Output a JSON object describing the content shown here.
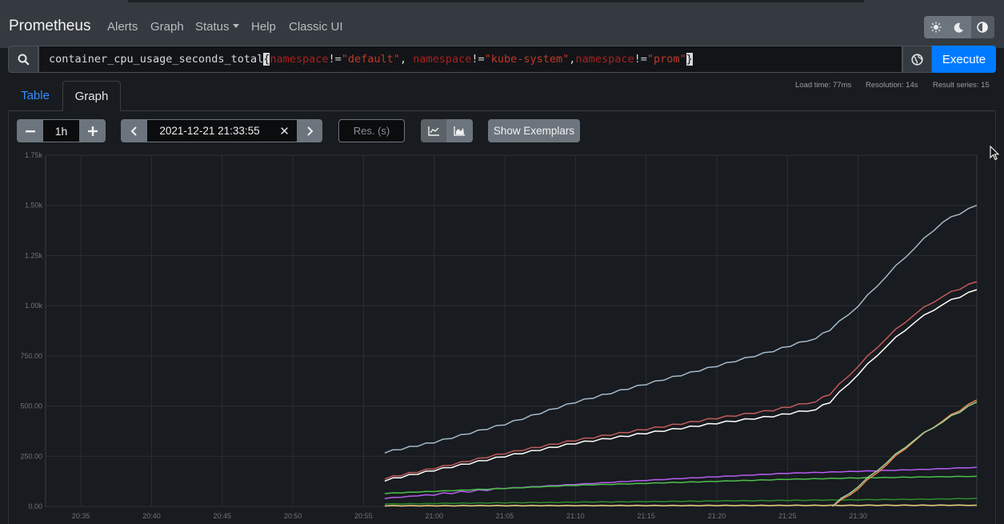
{
  "navbar": {
    "brand": "Prometheus",
    "items": [
      {
        "label": "Alerts"
      },
      {
        "label": "Graph"
      },
      {
        "label": "Status"
      },
      {
        "label": "Help"
      },
      {
        "label": "Classic UI"
      }
    ],
    "theme_icons": [
      "sun-icon",
      "moon-icon",
      "contrast-icon"
    ]
  },
  "query": {
    "metric": "container_cpu_usage_seconds_total",
    "open_brace": "{",
    "close_brace": "}",
    "matchers": [
      {
        "label": "namespace",
        "op": "!=",
        "value": "\"default\"",
        "sep": ", "
      },
      {
        "label": "namespace",
        "op": "!=",
        "value": "\"kube-system\"",
        "sep": ","
      },
      {
        "label": "namespace",
        "op": "!=",
        "value": "\"prom\"",
        "sep": ""
      }
    ],
    "execute_label": "Execute"
  },
  "stats": {
    "load_time": "Load time: 77ms",
    "resolution": "Resolution: 14s",
    "result_series": "Result series: 15"
  },
  "tabs": {
    "table": "Table",
    "graph": "Graph"
  },
  "controls": {
    "range": "1h",
    "end_time": "2021-12-21 21:33:55",
    "clear": "✕",
    "res_placeholder": "Res. (s)",
    "show_exemplars": "Show Exemplars"
  },
  "colors": {
    "accent": "#007bff",
    "navbar": "#343a40",
    "background": "#181b1f"
  },
  "chart_data": {
    "type": "line",
    "xlabel": "",
    "ylabel": "",
    "x_ticks": [
      "20:35",
      "20:40",
      "20:45",
      "20:50",
      "20:55",
      "21:00",
      "21:05",
      "21:10",
      "21:15",
      "21:20",
      "21:25",
      "21:30"
    ],
    "y_ticks": [
      "0.00",
      "250.00",
      "500.00",
      "750.00",
      "1.00k",
      "1.25k",
      "1.50k",
      "1.75k"
    ],
    "xlim_minutes": [
      20.6,
      33.9
    ],
    "ylim": [
      0,
      1750
    ],
    "grid": true,
    "series": [
      {
        "color": "#a2b9cc",
        "points": [
          [
            56.5,
            270
          ],
          [
            60,
            320
          ],
          [
            65,
            410
          ],
          [
            70,
            520
          ],
          [
            75,
            610
          ],
          [
            80,
            700
          ],
          [
            84,
            775
          ],
          [
            87,
            840
          ],
          [
            88,
            880
          ],
          [
            90,
            1000
          ],
          [
            92,
            1150
          ],
          [
            94,
            1290
          ],
          [
            96,
            1420
          ],
          [
            98.4,
            1500
          ]
        ]
      },
      {
        "color": "#c25a5a",
        "points": [
          [
            56.5,
            140
          ],
          [
            60,
            190
          ],
          [
            65,
            265
          ],
          [
            70,
            330
          ],
          [
            75,
            385
          ],
          [
            80,
            440
          ],
          [
            84,
            480
          ],
          [
            87,
            525
          ],
          [
            88,
            560
          ],
          [
            90,
            700
          ],
          [
            92,
            840
          ],
          [
            94,
            960
          ],
          [
            96,
            1050
          ],
          [
            98.4,
            1120
          ]
        ]
      },
      {
        "color": "#ffffff",
        "points": [
          [
            56.5,
            130
          ],
          [
            60,
            180
          ],
          [
            65,
            250
          ],
          [
            70,
            315
          ],
          [
            75,
            365
          ],
          [
            80,
            415
          ],
          [
            84,
            450
          ],
          [
            87,
            485
          ],
          [
            88,
            520
          ],
          [
            90,
            660
          ],
          [
            92,
            800
          ],
          [
            94,
            920
          ],
          [
            96,
            1010
          ],
          [
            98.4,
            1080
          ]
        ]
      },
      {
        "color": "#b55cf0",
        "points": [
          [
            56.5,
            40
          ],
          [
            60,
            60
          ],
          [
            65,
            90
          ],
          [
            70,
            110
          ],
          [
            75,
            130
          ],
          [
            80,
            148
          ],
          [
            85,
            165
          ],
          [
            90,
            175
          ],
          [
            95,
            185
          ],
          [
            98.4,
            195
          ]
        ]
      },
      {
        "color": "#4cbf4c",
        "points": [
          [
            56.5,
            65
          ],
          [
            60,
            75
          ],
          [
            65,
            90
          ],
          [
            70,
            105
          ],
          [
            75,
            115
          ],
          [
            80,
            125
          ],
          [
            85,
            135
          ],
          [
            90,
            142
          ],
          [
            95,
            147
          ],
          [
            98.4,
            150
          ]
        ]
      },
      {
        "color": "#2e8b2e",
        "points": [
          [
            56.5,
            12
          ],
          [
            65,
            18
          ],
          [
            75,
            24
          ],
          [
            85,
            30
          ],
          [
            95,
            36
          ],
          [
            98.4,
            40
          ]
        ]
      },
      {
        "color": "#f0d080",
        "points": [
          [
            56.5,
            3
          ],
          [
            70,
            4
          ],
          [
            85,
            5
          ],
          [
            98.4,
            6
          ]
        ]
      },
      {
        "color": "#e88a50",
        "points": [
          [
            88.2,
            0
          ],
          [
            90,
            90
          ],
          [
            92,
            210
          ],
          [
            94,
            330
          ],
          [
            96,
            430
          ],
          [
            98.4,
            530
          ]
        ]
      },
      {
        "color": "#9ccc9c",
        "points": [
          [
            88.2,
            5
          ],
          [
            90,
            100
          ],
          [
            92,
            220
          ],
          [
            94,
            335
          ],
          [
            96,
            425
          ],
          [
            98.4,
            520
          ]
        ]
      }
    ]
  }
}
